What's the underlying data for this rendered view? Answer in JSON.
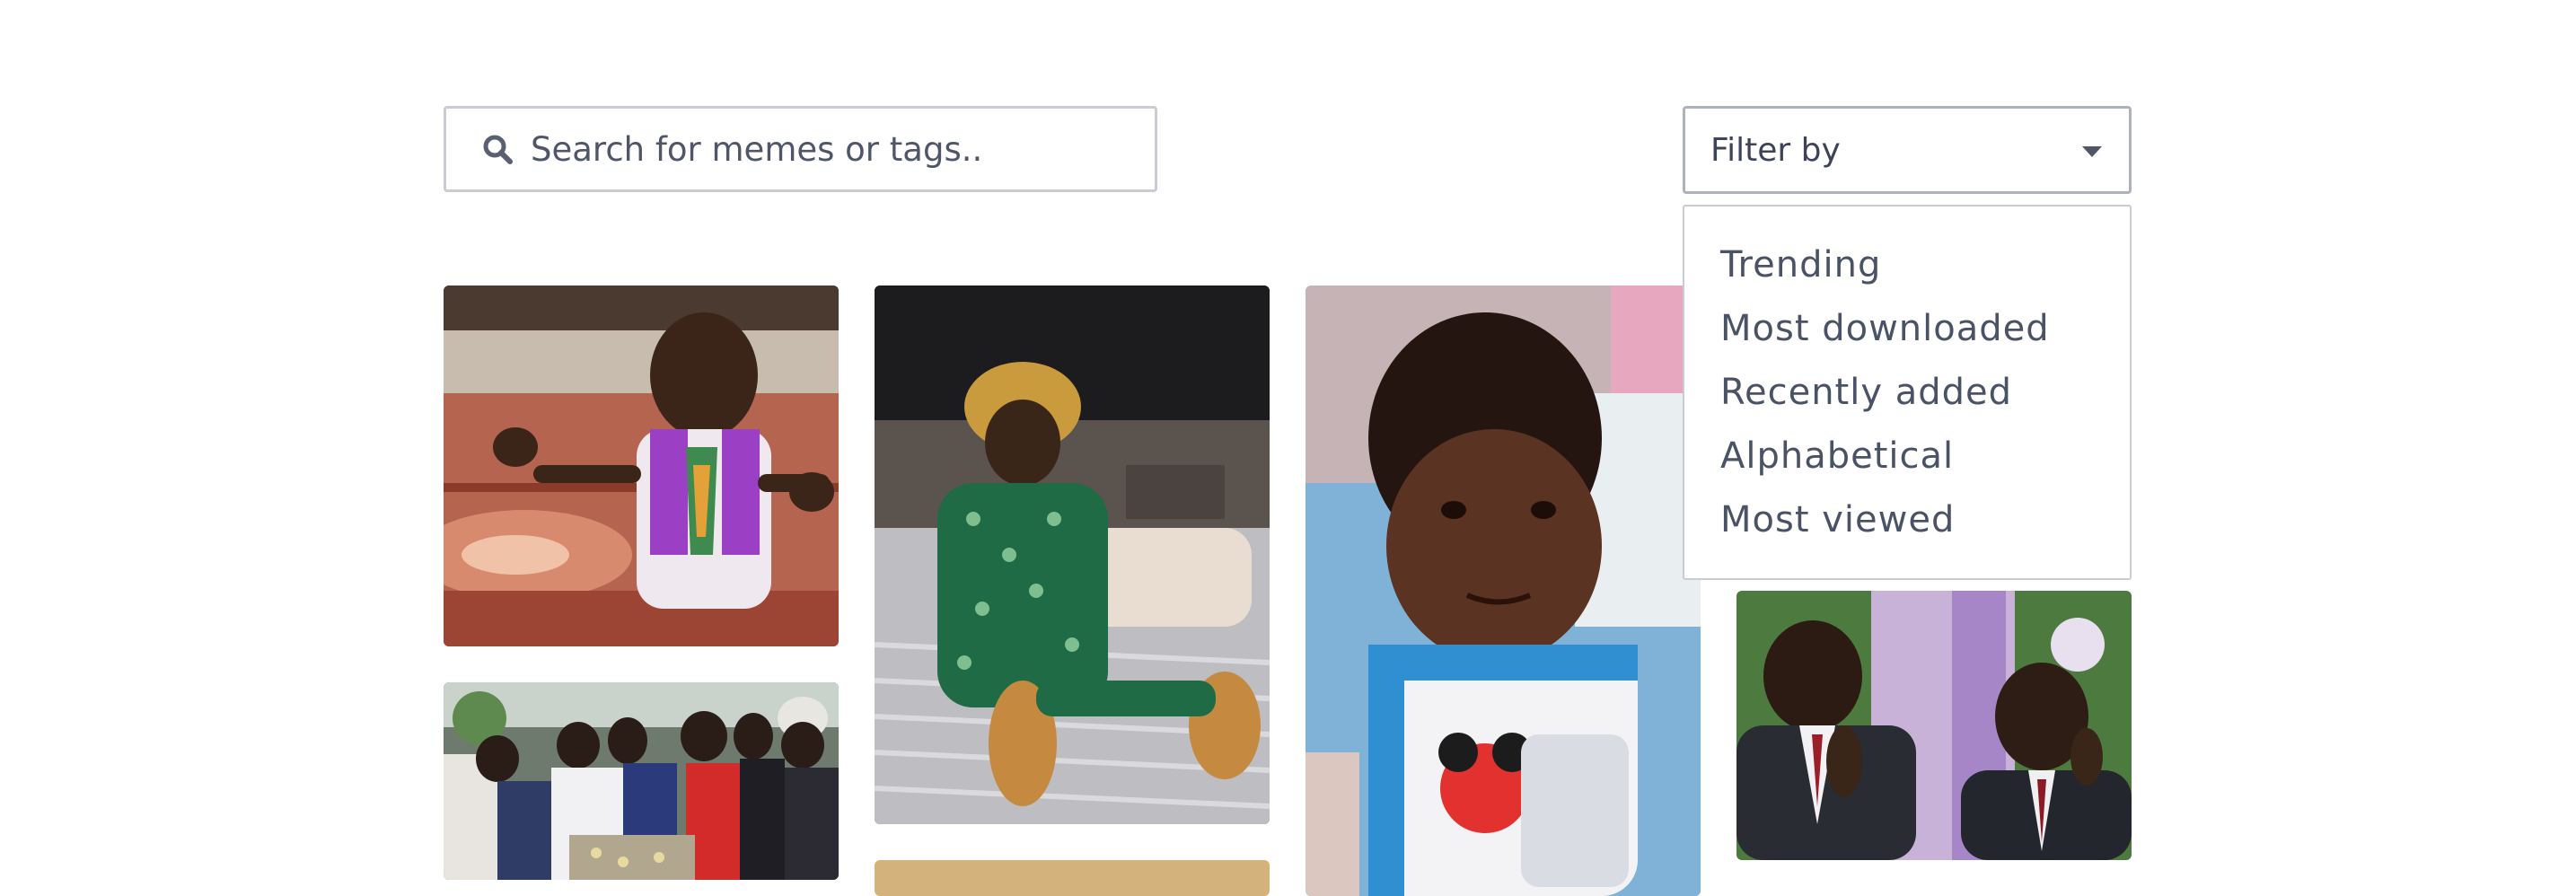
{
  "search": {
    "placeholder": "Search for memes or tags..",
    "icon": "search-icon"
  },
  "filter": {
    "label": "Filter by",
    "icon": "caret-down-icon",
    "options": [
      "Trending",
      "Most downloaded",
      "Recently added",
      "Alphabetical",
      "Most viewed"
    ]
  },
  "colors": {
    "border": "#c9ccd4",
    "text": "#3d4458"
  }
}
